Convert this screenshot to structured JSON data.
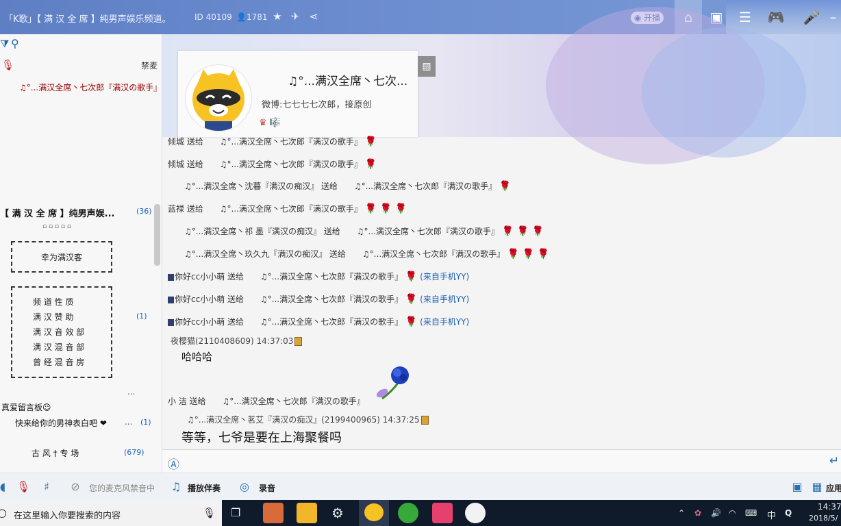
{
  "titlebar": {
    "title": "「K歌」【 满 汉 全 席 】纯男声娱乐频道。",
    "id_label": "ID 40109",
    "members": "1781",
    "live_label": "开播"
  },
  "sidebar": {
    "mute_label": "禁麦",
    "host_name": "♫°...满汉全席丶七次郎『满汉の歌手』",
    "channel_name": "【 满 汉 全 席 】纯男声娱...",
    "channel_count": "(36)",
    "decoration": "▫ ▫ ▫ ▫ ▫",
    "welcome_box": "幸为满汉客",
    "menu_items": [
      "频 道 性 质",
      "满 汉 赞 助",
      "满 汉 音 效 部",
      "满 汉 混 音 部",
      "曾 经 混 音 房"
    ],
    "menu_count": "(1)",
    "ellipsis": "...",
    "board_title": "真爱留言板☺",
    "board_item": "快来给你的男神表白吧 ❤",
    "board_count": "(1)",
    "board_dots": "...",
    "room_name": "古 风 † 专 场",
    "room_count": "(679)"
  },
  "profile": {
    "name": "♫°...满汉全席丶七次...",
    "bio": "微博:七七七七次郎，接原创",
    "badges": "♛ 🎼"
  },
  "chat": {
    "gifts": [
      {
        "sender": "倾城",
        "verb": "送给",
        "receiver": "♫°...满汉全席丶七次郎『满汉の歌手』",
        "roses": "🌹",
        "mobile": ""
      },
      {
        "sender": "倾城",
        "verb": "送给",
        "receiver": "♫°...满汉全席丶七次郎『满汉の歌手』",
        "roses": "🌹",
        "mobile": ""
      },
      {
        "sender": "♫°...满汉全席丶沈暮『满汉の痴汉』",
        "verb": "送给",
        "receiver": "♫°...满汉全席丶七次郎『满汉の歌手』",
        "roses": "🌹",
        "mobile": ""
      },
      {
        "sender": "蓝禄",
        "verb": "送给",
        "receiver": "♫°...满汉全席丶七次郎『满汉の歌手』",
        "roses": "🌹 🌹 🌹",
        "mobile": ""
      },
      {
        "sender": "♫°...满汉全席丶祁 墨『满汉の痴汉』",
        "verb": "送给",
        "receiver": "♫°...满汉全席丶七次郎『满汉の歌手』",
        "roses": "🌹 🌹 🌹",
        "mobile": ""
      },
      {
        "sender": "♫°...满汉全席丶玖久九『满汉の痴汉』",
        "verb": "送给",
        "receiver": "♫°...满汉全席丶七次郎『满汉の歌手』",
        "roses": "🌹 🌹 🌹",
        "mobile": ""
      },
      {
        "sender": "你好cc小小萌",
        "verb": "送给",
        "receiver": "♫°...满汉全席丶七次郎『满汉の歌手』",
        "roses": "🌹",
        "mobile": "(来自手机YY)"
      },
      {
        "sender": "你好cc小小萌",
        "verb": "送给",
        "receiver": "♫°...满汉全席丶七次郎『满汉の歌手』",
        "roses": "🌹",
        "mobile": "(来自手机YY)"
      },
      {
        "sender": "你好cc小小萌",
        "verb": "送给",
        "receiver": "♫°...满汉全席丶七次郎『满汉の歌手』",
        "roses": "🌹",
        "mobile": "(来自手机YY)"
      }
    ],
    "msg1_user": "夜樱猫(2110408609) 14:37:03",
    "msg1_text": "哈哈哈",
    "gift2_sender": "小 洁",
    "gift2_verb": "送给",
    "gift2_receiver": "♫°...满汉全席丶七次郎『满汉の歌手』",
    "msg2_user": "♫°...满汉全席丶茗艾『满汉の痴汉』(2199400965) 14:37:25",
    "msg2_text": "等等，七爷是要在上海聚餐吗"
  },
  "toolbar": {
    "mic_muted": "您的麦克风禁音中",
    "play_accompaniment": "播放伴奏",
    "record": "录音",
    "apps": "应用"
  },
  "taskbar": {
    "search_placeholder": "在这里输入你要搜索的内容",
    "ime": "中",
    "time": "14:37",
    "date": "2018/5/"
  },
  "colors": {
    "titlebar": "#6d8ed0",
    "link_blue": "#1a60b8",
    "rose_red": "#c81e1e",
    "taskbar": "#0f1a2a"
  }
}
